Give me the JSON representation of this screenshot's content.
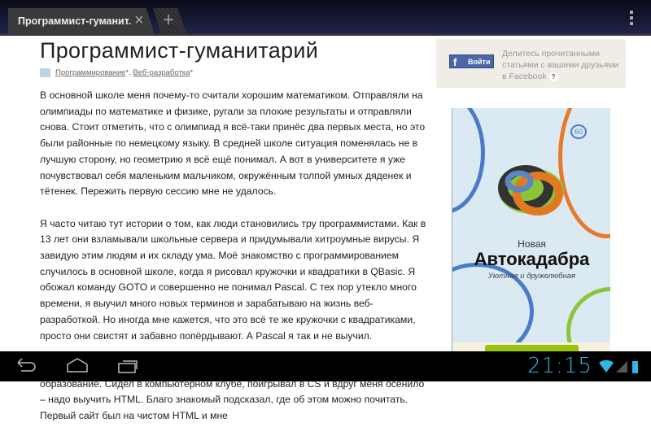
{
  "browser": {
    "tab_title": "Программист-гуманит.",
    "close_icon": "×",
    "new_tab_icon": "+"
  },
  "article": {
    "title": "Программист-гуманитарий",
    "hubs": [
      "Программирование",
      "Веб-разработка"
    ],
    "hub_sep": ", ",
    "star": "*",
    "paragraphs": [
      "В основной школе меня почему-то считали хорошим математиком. Отправляли на олимпиады по математике и физике, ругали за плохие результаты и отправляли снова. Стоит отметить, что с олимпиад я всё-таки принёс два первых места, но это были районные по немецкому языку. В средней школе ситуация поменялась не в лучшую сторону, но геометрию я всё ещё понимал. А вот в университете я уже почувствовал себя маленьким мальчиком, окружённым толпой умных дяденек и тётенек. Пережить первую сессию мне не удалось.",
      "Я часто читаю тут истории о том, как люди становились тру программистами. Как в 13 лет они взламывали школьные сервера и придумывали хитроумные вирусы. Я завидую этим людям и их складу ума. Моё знакомство с программированием случилось в основной школе, когда я рисовал кружочки и квадратики в QBasic. Я обожал команду GOTO и совершенно не понимал Pascal. С тех пор утекло много времени, я выучил много новых терминов и зарабатываю на жизнь веб-разработкой. Но иногда мне кажется, что это всё те же кружочки с квадратиками, просто они свистят и забавно попёрдывают. А Pascal я так и не выучил.",
      "Сайты я начал делать сразу после неудачной попытки получить высшее образование. Сидел в компьютерном клубе, поигрывал в CS и вдруг меня осенило – надо выучить HTML. Благо знакомый подсказал, где об этом можно почитать. Первый сайт был на чистом HTML и мне"
    ]
  },
  "facebook": {
    "login_label": "Войти",
    "logo": "f",
    "text": "Делитесь прочитанными статьями с вашими друзьями в Facebook",
    "help": "?"
  },
  "ad": {
    "kicker": "Новая",
    "title": "Автокадабра",
    "subtitle": "Уютная и дружелюбная",
    "sign": "60"
  },
  "statusbar": {
    "time": "21:15"
  },
  "colors": {
    "accent": "#33b5e5",
    "fb": "#4a67a8"
  }
}
